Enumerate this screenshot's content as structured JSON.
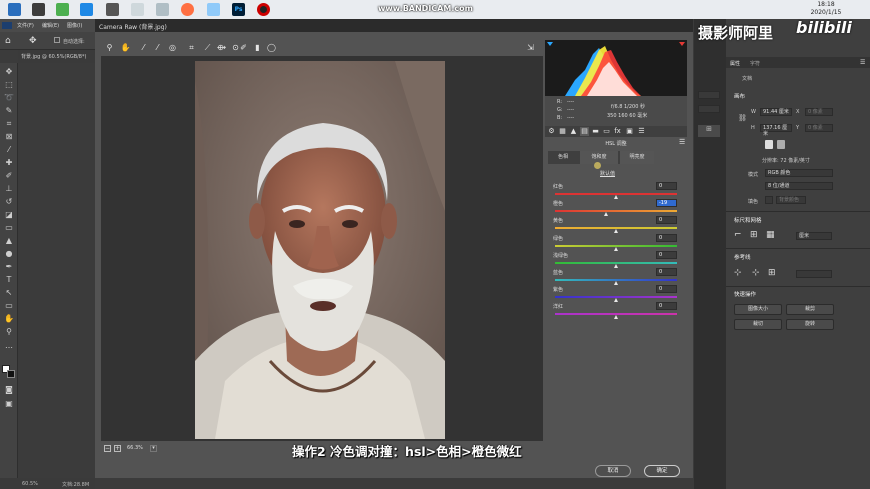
{
  "recorder": {
    "watermark": "www.BANDICAM.com"
  },
  "clock": {
    "time": "18:18",
    "date": "2020/1/15"
  },
  "photoshop": {
    "menu": [
      "文件(F)",
      "编辑(E)",
      "图像(I)"
    ],
    "options_label": "自动选择:",
    "doc_tab": "背景.jpg @ 60.5%(RGB/8*)",
    "status_zoom": "60.5%",
    "status_doc": "文档:28.8M"
  },
  "camera_raw": {
    "title": "Camera Raw (背景.jpg)",
    "readout": {
      "r_label": "R:",
      "g_label": "G:",
      "b_label": "B:",
      "r": "----",
      "g": "----",
      "b": "----",
      "exposure": "f/6.8  1/200 秒",
      "iso": "350  160   60 毫米"
    },
    "panel_title": "HSL 调整",
    "subtabs": [
      "色相",
      "饱和度",
      "明亮度"
    ],
    "default_link": "默认值",
    "sliders": [
      {
        "label": "红色",
        "value": "0",
        "pos": 0.5,
        "active": false,
        "c1": "#d33",
        "c2": "#d33"
      },
      {
        "label": "橙色",
        "value": "-19",
        "pos": 0.42,
        "active": true,
        "c1": "#d33",
        "c2": "#ea3"
      },
      {
        "label": "黄色",
        "value": "0",
        "pos": 0.5,
        "active": false,
        "c1": "#ea3",
        "c2": "#cc3"
      },
      {
        "label": "绿色",
        "value": "0",
        "pos": 0.5,
        "active": false,
        "c1": "#cc3",
        "c2": "#3b3"
      },
      {
        "label": "浅绿色",
        "value": "0",
        "pos": 0.5,
        "active": false,
        "c1": "#3b3",
        "c2": "#3bb"
      },
      {
        "label": "蓝色",
        "value": "0",
        "pos": 0.5,
        "active": false,
        "c1": "#3bb",
        "c2": "#33c"
      },
      {
        "label": "紫色",
        "value": "0",
        "pos": 0.5,
        "active": false,
        "c1": "#33c",
        "c2": "#a3c"
      },
      {
        "label": "洋红",
        "value": "0",
        "pos": 0.5,
        "active": false,
        "c1": "#a3c",
        "c2": "#c3a"
      }
    ],
    "zoom_value": "66.3%",
    "cancel_label": "取消",
    "ok_label": "确定"
  },
  "overlay_text": {
    "subtitle": "操作2  冷色调对撞：hsl>色相>橙色微红",
    "channel_name": "摄影师阿里",
    "bili": "bilibili"
  },
  "right_panel": {
    "tabs": [
      "属性",
      "字符"
    ],
    "doc_label": "文档",
    "canvas_head": "画布",
    "w_label": "W",
    "h_label": "H",
    "x_label": "X",
    "y_label": "Y",
    "w_value": "91.44 厘米",
    "h_value": "137.16 厘米",
    "x_ph": "0 像素",
    "y_ph": "0 像素",
    "resolution": "分辨率: 72 像素/英寸",
    "mode_label": "模式",
    "mode_value": "RGB 颜色",
    "depth_value": "8 位/通道",
    "fill_label": "填色",
    "fill_value": "背景颜色",
    "rulers_head": "标尺和网格",
    "unit_value": "厘米",
    "guides_head": "参考线",
    "quick_head": "快速操作",
    "btn_image_size": "图像大小",
    "btn_crop": "裁剪",
    "btn_trim": "裁切",
    "btn_rotate": "旋转"
  }
}
